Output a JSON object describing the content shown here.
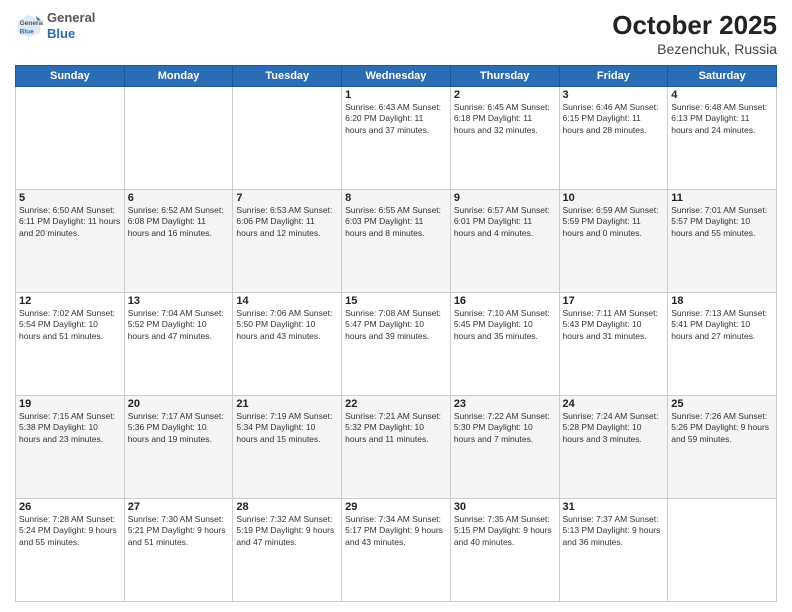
{
  "header": {
    "logo_general": "General",
    "logo_blue": "Blue",
    "title": "October 2025",
    "subtitle": "Bezenchuk, Russia"
  },
  "weekdays": [
    "Sunday",
    "Monday",
    "Tuesday",
    "Wednesday",
    "Thursday",
    "Friday",
    "Saturday"
  ],
  "weeks": [
    [
      {
        "day": "",
        "info": ""
      },
      {
        "day": "",
        "info": ""
      },
      {
        "day": "",
        "info": ""
      },
      {
        "day": "1",
        "info": "Sunrise: 6:43 AM\nSunset: 6:20 PM\nDaylight: 11 hours\nand 37 minutes."
      },
      {
        "day": "2",
        "info": "Sunrise: 6:45 AM\nSunset: 6:18 PM\nDaylight: 11 hours\nand 32 minutes."
      },
      {
        "day": "3",
        "info": "Sunrise: 6:46 AM\nSunset: 6:15 PM\nDaylight: 11 hours\nand 28 minutes."
      },
      {
        "day": "4",
        "info": "Sunrise: 6:48 AM\nSunset: 6:13 PM\nDaylight: 11 hours\nand 24 minutes."
      }
    ],
    [
      {
        "day": "5",
        "info": "Sunrise: 6:50 AM\nSunset: 6:11 PM\nDaylight: 11 hours\nand 20 minutes."
      },
      {
        "day": "6",
        "info": "Sunrise: 6:52 AM\nSunset: 6:08 PM\nDaylight: 11 hours\nand 16 minutes."
      },
      {
        "day": "7",
        "info": "Sunrise: 6:53 AM\nSunset: 6:06 PM\nDaylight: 11 hours\nand 12 minutes."
      },
      {
        "day": "8",
        "info": "Sunrise: 6:55 AM\nSunset: 6:03 PM\nDaylight: 11 hours\nand 8 minutes."
      },
      {
        "day": "9",
        "info": "Sunrise: 6:57 AM\nSunset: 6:01 PM\nDaylight: 11 hours\nand 4 minutes."
      },
      {
        "day": "10",
        "info": "Sunrise: 6:59 AM\nSunset: 5:59 PM\nDaylight: 11 hours\nand 0 minutes."
      },
      {
        "day": "11",
        "info": "Sunrise: 7:01 AM\nSunset: 5:57 PM\nDaylight: 10 hours\nand 55 minutes."
      }
    ],
    [
      {
        "day": "12",
        "info": "Sunrise: 7:02 AM\nSunset: 5:54 PM\nDaylight: 10 hours\nand 51 minutes."
      },
      {
        "day": "13",
        "info": "Sunrise: 7:04 AM\nSunset: 5:52 PM\nDaylight: 10 hours\nand 47 minutes."
      },
      {
        "day": "14",
        "info": "Sunrise: 7:06 AM\nSunset: 5:50 PM\nDaylight: 10 hours\nand 43 minutes."
      },
      {
        "day": "15",
        "info": "Sunrise: 7:08 AM\nSunset: 5:47 PM\nDaylight: 10 hours\nand 39 minutes."
      },
      {
        "day": "16",
        "info": "Sunrise: 7:10 AM\nSunset: 5:45 PM\nDaylight: 10 hours\nand 35 minutes."
      },
      {
        "day": "17",
        "info": "Sunrise: 7:11 AM\nSunset: 5:43 PM\nDaylight: 10 hours\nand 31 minutes."
      },
      {
        "day": "18",
        "info": "Sunrise: 7:13 AM\nSunset: 5:41 PM\nDaylight: 10 hours\nand 27 minutes."
      }
    ],
    [
      {
        "day": "19",
        "info": "Sunrise: 7:15 AM\nSunset: 5:38 PM\nDaylight: 10 hours\nand 23 minutes."
      },
      {
        "day": "20",
        "info": "Sunrise: 7:17 AM\nSunset: 5:36 PM\nDaylight: 10 hours\nand 19 minutes."
      },
      {
        "day": "21",
        "info": "Sunrise: 7:19 AM\nSunset: 5:34 PM\nDaylight: 10 hours\nand 15 minutes."
      },
      {
        "day": "22",
        "info": "Sunrise: 7:21 AM\nSunset: 5:32 PM\nDaylight: 10 hours\nand 11 minutes."
      },
      {
        "day": "23",
        "info": "Sunrise: 7:22 AM\nSunset: 5:30 PM\nDaylight: 10 hours\nand 7 minutes."
      },
      {
        "day": "24",
        "info": "Sunrise: 7:24 AM\nSunset: 5:28 PM\nDaylight: 10 hours\nand 3 minutes."
      },
      {
        "day": "25",
        "info": "Sunrise: 7:26 AM\nSunset: 5:26 PM\nDaylight: 9 hours\nand 59 minutes."
      }
    ],
    [
      {
        "day": "26",
        "info": "Sunrise: 7:28 AM\nSunset: 5:24 PM\nDaylight: 9 hours\nand 55 minutes."
      },
      {
        "day": "27",
        "info": "Sunrise: 7:30 AM\nSunset: 5:21 PM\nDaylight: 9 hours\nand 51 minutes."
      },
      {
        "day": "28",
        "info": "Sunrise: 7:32 AM\nSunset: 5:19 PM\nDaylight: 9 hours\nand 47 minutes."
      },
      {
        "day": "29",
        "info": "Sunrise: 7:34 AM\nSunset: 5:17 PM\nDaylight: 9 hours\nand 43 minutes."
      },
      {
        "day": "30",
        "info": "Sunrise: 7:35 AM\nSunset: 5:15 PM\nDaylight: 9 hours\nand 40 minutes."
      },
      {
        "day": "31",
        "info": "Sunrise: 7:37 AM\nSunset: 5:13 PM\nDaylight: 9 hours\nand 36 minutes."
      },
      {
        "day": "",
        "info": ""
      }
    ]
  ]
}
